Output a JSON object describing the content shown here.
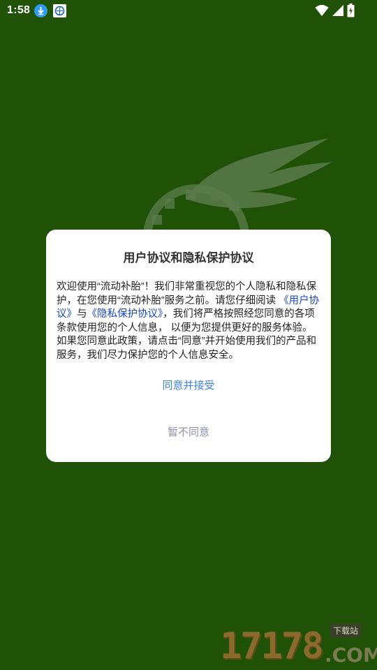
{
  "status_bar": {
    "time": "1:58",
    "icons": [
      "download-icon",
      "app-notification-icon",
      "wifi-icon",
      "signal-icon",
      "battery-charging-icon"
    ]
  },
  "dialog": {
    "title": "用户协议和隐私保护协议",
    "body_part1": "欢迎使用“流动补胎”！我们非常重视您的个人隐私和隐私保护，在您使用“流动补胎”服务之前。请您仔细阅读",
    "link_user_agreement": "《用户协议》",
    "body_part2": "与",
    "link_privacy_policy": "《隐私保护协议》",
    "body_part3": "，我们将严格按照经您同意的各项条款使用您的个人信息， 以便为您提供更好的服务体验。 如果您同意此政策，请点击“同意”并开始使用我们的产品和服务，我们尽力保护您的个人信息安全。",
    "agree_label": "同意并接受",
    "disagree_label": "暂不同意"
  },
  "watermark": {
    "digits": "17178",
    "domain": ".COM",
    "tag": "下载站"
  },
  "colors": {
    "background": "#1f5207",
    "link": "#1a47c8",
    "agree": "#3f82e0",
    "disagree": "#8b8fa8"
  }
}
